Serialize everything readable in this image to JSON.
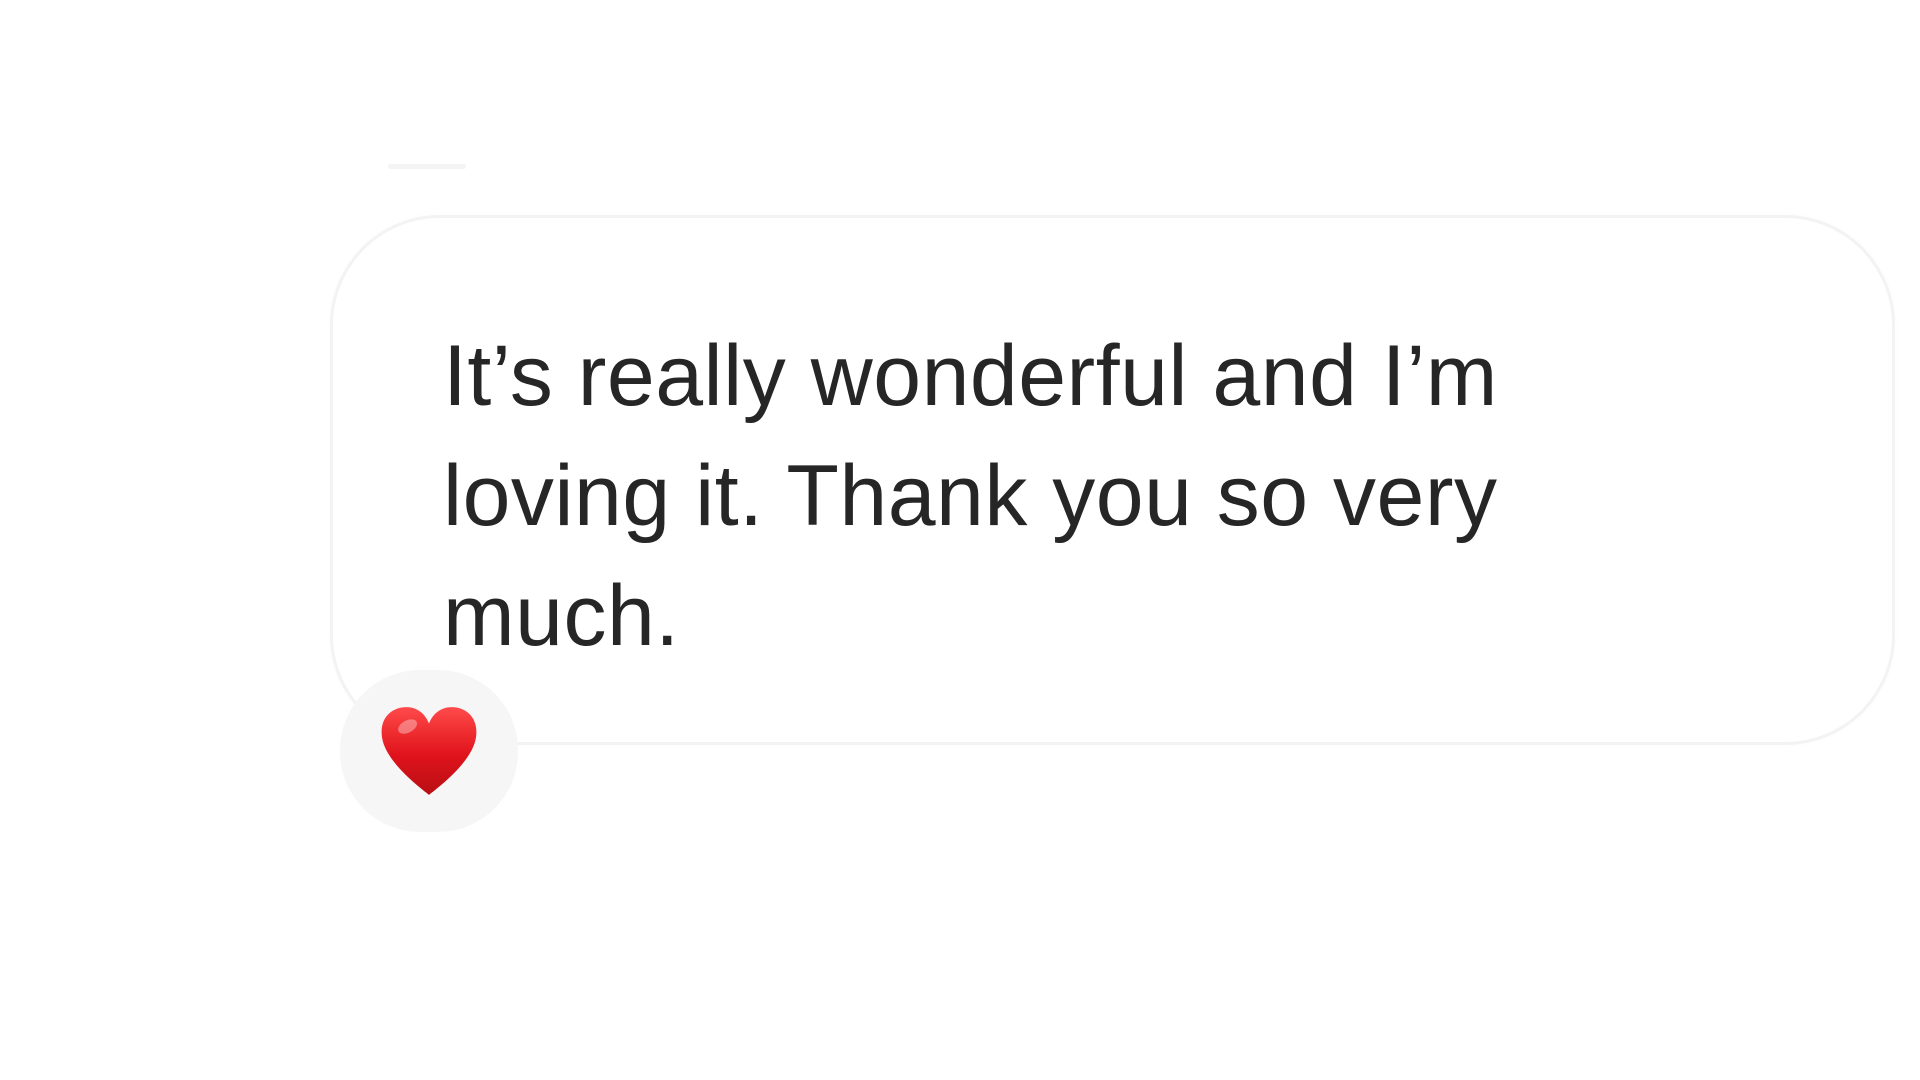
{
  "message": {
    "text": "It’s really wonderful and I’m loving it. Thank you so very much.",
    "reaction": {
      "icon": "heart-icon",
      "color": "#E0131B"
    }
  },
  "colors": {
    "background": "#FFFFFF",
    "bubble_border": "#F3F3F3",
    "text": "#262626",
    "reaction_background": "#F6F6F6"
  }
}
